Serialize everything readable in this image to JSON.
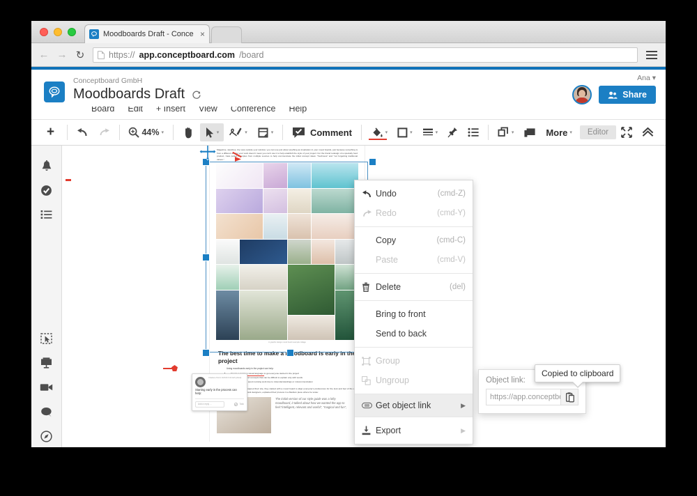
{
  "browser": {
    "tab_title": "Moodboards Draft - Conce",
    "tab_close": "×",
    "url_prefix": "https://",
    "url_domain": "app.conceptboard.com",
    "url_path": "/board",
    "back_icon": "←",
    "forward_icon": "→",
    "reload_icon": "↻"
  },
  "header": {
    "org": "Conceptboard GmbH",
    "title": "Moodboards Draft",
    "sync_icon": "sync-icon",
    "user": "Ana",
    "user_caret": "▾",
    "share_label": "Share",
    "accent": "#1b7fc4"
  },
  "menubar": {
    "items": [
      "Board",
      "Edit",
      "+ Insert",
      "View",
      "Conference",
      "Help"
    ]
  },
  "toolbar": {
    "add_label": "+",
    "zoom_value": "44%",
    "comment_label": "Comment",
    "more_label": "More",
    "editor_label": "Editor",
    "caret": "▾",
    "highlight_color": "#e23b2e"
  },
  "sidebar": {
    "top_items": [
      "bell-icon",
      "check-circle-icon",
      "list-icon"
    ],
    "bottom_items": [
      "select-area-icon",
      "presentation-icon",
      "video-camera-icon",
      "chat-icon",
      "compass-icon"
    ]
  },
  "context_menu": {
    "groups": [
      [
        {
          "label": "Undo",
          "shortcut": "(cmd-Z)",
          "icon": "undo-icon",
          "disabled": false,
          "submenu": false
        },
        {
          "label": "Redo",
          "shortcut": "(cmd-Y)",
          "icon": "redo-icon",
          "disabled": true,
          "submenu": false
        }
      ],
      [
        {
          "label": "Copy",
          "shortcut": "(cmd-C)",
          "icon": "",
          "disabled": false,
          "submenu": false
        },
        {
          "label": "Paste",
          "shortcut": "(cmd-V)",
          "icon": "",
          "disabled": true,
          "submenu": false
        }
      ],
      [
        {
          "label": "Delete",
          "shortcut": "(del)",
          "icon": "trash-icon",
          "disabled": false,
          "submenu": false
        }
      ],
      [
        {
          "label": "Bring to front",
          "shortcut": "",
          "icon": "",
          "disabled": false,
          "submenu": false
        },
        {
          "label": "Send to back",
          "shortcut": "",
          "icon": "",
          "disabled": false,
          "submenu": false
        }
      ],
      [
        {
          "label": "Group",
          "shortcut": "",
          "icon": "group-icon",
          "disabled": true,
          "submenu": false
        },
        {
          "label": "Ungroup",
          "shortcut": "",
          "icon": "ungroup-icon",
          "disabled": true,
          "submenu": false
        }
      ],
      [
        {
          "label": "Get object link",
          "shortcut": "",
          "icon": "link-icon",
          "disabled": false,
          "submenu": true,
          "highlighted": true
        }
      ],
      [
        {
          "label": "Export",
          "shortcut": "",
          "icon": "export-icon",
          "disabled": true,
          "submenu": true
        }
      ]
    ],
    "arrow": "▶"
  },
  "link_popover": {
    "label": "Object link:",
    "value": "https://app.conceptboard",
    "copy_icon": "clipboard-icon"
  },
  "tooltip": {
    "text": "Copied to clipboard"
  },
  "canvas": {
    "doc_paragraph": "Magazine, sketches, the view outside your window: you can use just about anything as inspiration in your mood boards, just because something is from a different era for your work doesn't mean you can't use it to help establish the style of your project. For the brand redesign of a specialty food product, Cara pulled examples from multiple sources to help communicate the initial concept ideas: \"freshness\" and \"not forgetting traditional values.\"",
    "collage_caption": "in graphic design mood board example collage",
    "heading": "The best time to make a moodboard is early in the project",
    "subhead": "Using moodboards early in the project can help:",
    "bullets": [
      "Create a common visual language to get everyone started in the project",
      "Translate ideas and concepts that can be difficult to explain only with words",
      "Cut down on time spent revising work due to misunderstandings or miscommunication"
    ],
    "trailing": "When the team at Flourish redesigned their site, they started with a mood board to align everyone's preferences for the look and feel of the app. Sam Brown, one of the Flourishpark designers, explained their process in a Medium piece where he wrote:",
    "quote": "The initial version of our style guide was a lofty moodboard, it talked about how we wanted the app to feel:\"intelligent, relevant and useful\", \"magical and fun\",",
    "comment": {
      "author": "Charlene Perrin 3/23/16 9:43 AM (edited)",
      "text": "Starting early in the process can help:",
      "reply_placeholder": "Add a reply ...",
      "task_label": "Task"
    }
  }
}
